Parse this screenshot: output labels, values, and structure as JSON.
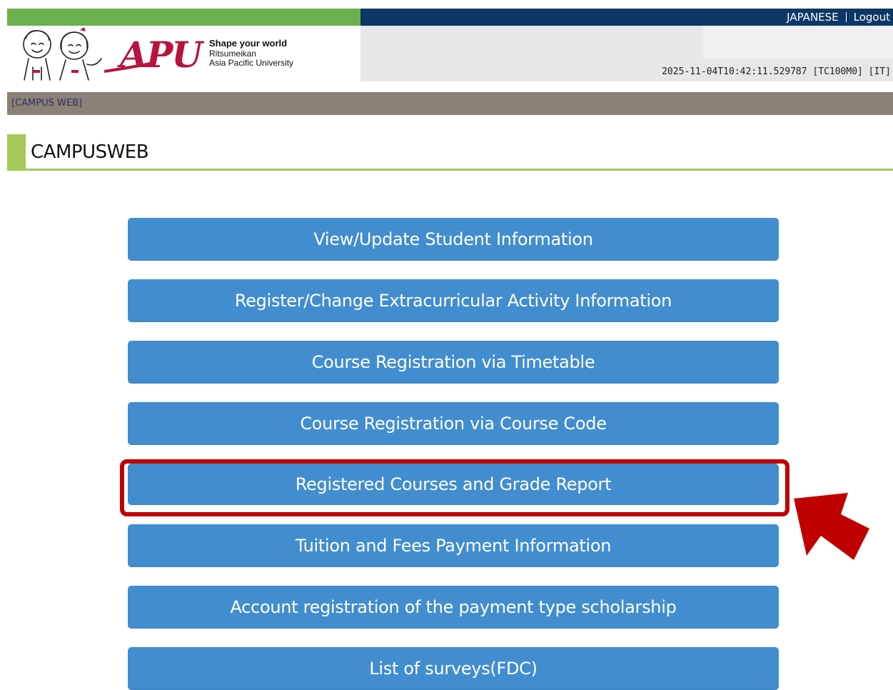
{
  "top_links": {
    "language": "JAPANESE",
    "logout": "Logout"
  },
  "header": {
    "logo_text": "APU",
    "tagline": "Shape your world",
    "university_line1": "Ritsumeikan",
    "university_line2": "Asia Pacific University",
    "timestamp": "2025-11-04T10:42:11.529787 [TC100M0] [IT]"
  },
  "breadcrumb": "[CAMPUS WEB]",
  "page_title": "CAMPUSWEB",
  "menu": [
    "View/Update Student Information",
    "Register/Change Extracurricular Activity Information",
    "Course Registration via Timetable",
    "Course Registration via Course Code",
    "Registered Courses and Grade Report",
    "Tuition and Fees Payment Information",
    "Account registration of the payment type scholarship",
    "List of surveys(FDC)"
  ],
  "colors": {
    "button": "#428dcf",
    "highlight": "#c00000",
    "brand_green": "#6ab04c",
    "brand_navy": "#0d3866",
    "apu_red": "#b8123e"
  }
}
